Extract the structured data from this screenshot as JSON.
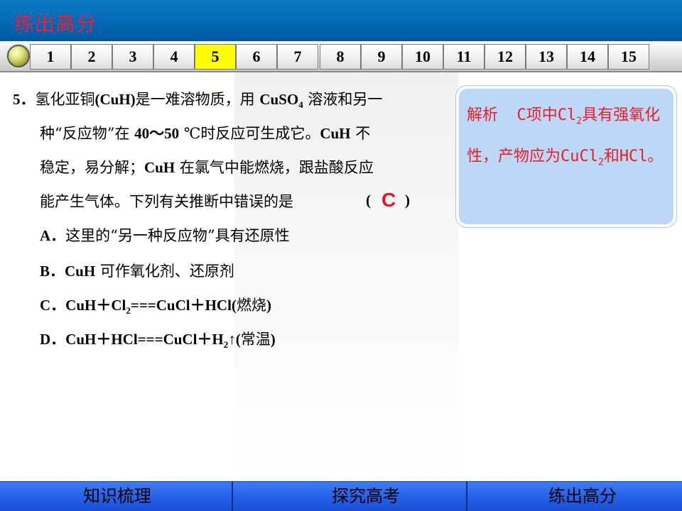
{
  "header": {
    "title": "练出高分"
  },
  "nav": {
    "numbers": [
      "1",
      "2",
      "3",
      "4",
      "5",
      "6",
      "7",
      "8",
      "9",
      "10",
      "11",
      "12",
      "13",
      "14",
      "15"
    ],
    "active": "5"
  },
  "question": {
    "line1": {
      "num": "5．",
      "t1": "氢化亚铜",
      "t2": "(CuH)",
      "t3": "是一难溶物质，用 ",
      "t4": "CuSO",
      "sub": "4",
      "t5": " 溶液和另一"
    },
    "line2": {
      "t1": "种“反应物”在 ",
      "t2": "40～50",
      "t3": " ℃时反应可生成它。",
      "t4": "CuH",
      "t5": " 不"
    },
    "line3": {
      "t1": "稳定，易分解；",
      "t2": "CuH",
      "t3": " 在氯气中能燃烧，跟盐酸反应"
    },
    "line4": {
      "t1": "能产生气体。下列有关推断中错误的是",
      "open": "(",
      "close": ")"
    },
    "answer": "C",
    "options": {
      "A": {
        "label": "A．",
        "text": "这里的“另一种反应物”具有还原性"
      },
      "B": {
        "label": "B．",
        "t1": "CuH",
        "t2": " 可作氧化剂、还原剂"
      },
      "C": {
        "label": "C．",
        "t1": "CuH＋Cl",
        "sub": "2",
        "t2": "===CuCl＋HCl(",
        "t3": "燃烧",
        "t4": ")"
      },
      "D": {
        "label": "D．",
        "t1": "CuH＋HCl===CuCl＋H",
        "sub": "2",
        "t2": "↑(",
        "t3": "常温",
        "t4": ")"
      }
    }
  },
  "analysis": {
    "label": "解析",
    "t1": "  C项中Cl",
    "sub1": "2",
    "t2": "具有强氧化性，产物应为CuCl",
    "sub2": "2",
    "t3": "和HCl。"
  },
  "footer": {
    "tabs": [
      "知识梳理",
      "探究高考",
      "练出高分"
    ]
  },
  "colors": {
    "accent_red": "#e6161d",
    "active_yellow": "#ffff00",
    "footer_blue": "#2460e8"
  }
}
